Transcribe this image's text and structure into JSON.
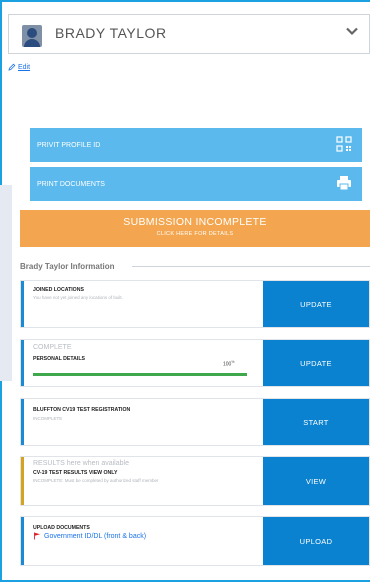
{
  "user": {
    "name": "BRADY TAYLOR"
  },
  "edit": {
    "label": "Edit"
  },
  "buttons": {
    "profile_id": "PRIVIT PROFILE ID",
    "print_docs": "PRINT DOCUMENTS"
  },
  "submission": {
    "title": "SUBMISSION INCOMPLETE",
    "subtitle": "CLICK HERE FOR DETAILS"
  },
  "section": {
    "title": "Brady Taylor Information"
  },
  "cards": [
    {
      "title": "JOINED LOCATIONS",
      "sub": "You have not yet joined any locations of built.",
      "action": "UPDATE"
    },
    {
      "status": "COMPLETE",
      "title": "PERSONAL DETAILS",
      "percent": "100",
      "percent_unit": "%",
      "action": "UPDATE"
    },
    {
      "title": "BLUFFTON CV19 TEST REGISTRATION",
      "sub": "INCOMPLETE",
      "action": "START"
    },
    {
      "status": "RESULTS here when available",
      "title": "CV-19 TEST RESULTS VIEW ONLY",
      "sub": "INCOMPLETE: Must be completed by authorized staff member",
      "action": "VIEW"
    },
    {
      "title": "UPLOAD DOCUMENTS",
      "link": "Government ID/DL (front & back)",
      "action": "UPLOAD"
    }
  ],
  "icons": {
    "chevron": "chevron-down-icon",
    "qr": "qr-code-icon",
    "printer": "printer-icon",
    "flag": "flag-icon",
    "pencil": "pencil-icon"
  },
  "colors": {
    "accent": "#1ba1e2",
    "orange": "#f3a64f",
    "blue_btn": "#5bb9ee",
    "action": "#0b82cf",
    "progress": "#3fa84c"
  },
  "progress_fraction": 1.0
}
